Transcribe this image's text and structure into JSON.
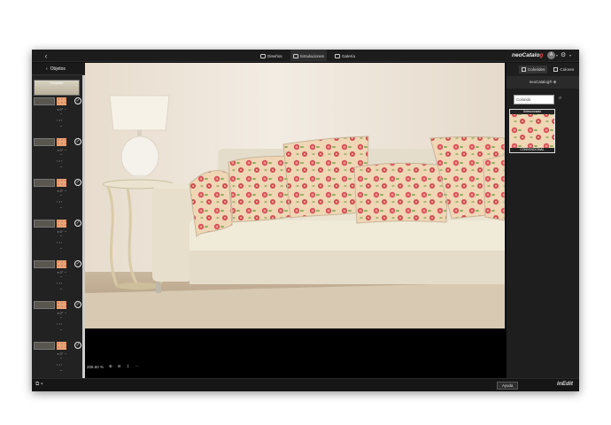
{
  "topbar": {
    "tabs": [
      {
        "label": "Diseños",
        "icon": "grid-icon"
      },
      {
        "label": "Simulaciones",
        "icon": "sofa-icon"
      },
      {
        "label": "Galería",
        "icon": "bookmark-icon"
      }
    ],
    "brand_text": "neoCatalo",
    "brand_accent": "g",
    "user_initial": "A"
  },
  "left_panel": {
    "title": "Objetos",
    "first_thumb_label": "Completo",
    "layers": [
      "capa-1",
      "capa-2",
      "capa-3",
      "capa-4",
      "capa-5",
      "capa-6",
      "capa-7"
    ]
  },
  "viewport": {
    "zoom_label": "208.60 %"
  },
  "right_panel": {
    "tabs": [
      {
        "label": "Colorides",
        "icon": "palette-icon"
      },
      {
        "label": "Colores",
        "icon": "drop-icon"
      }
    ],
    "info": "neoCatalog® ⊕",
    "search_value": "Colorido",
    "swatch_top": "Seleccionado",
    "swatch_bottom": "CONVENCIONAL"
  },
  "bottombar": {
    "help_label": "Ayuda",
    "brand": "inEdit"
  },
  "colors": {
    "pattern_bg": "#efd7b6",
    "pattern_flower": "#d8515a",
    "pattern_leaf": "#8fa85c",
    "wall": "#efe6da",
    "sofa": "#ece4d3"
  }
}
